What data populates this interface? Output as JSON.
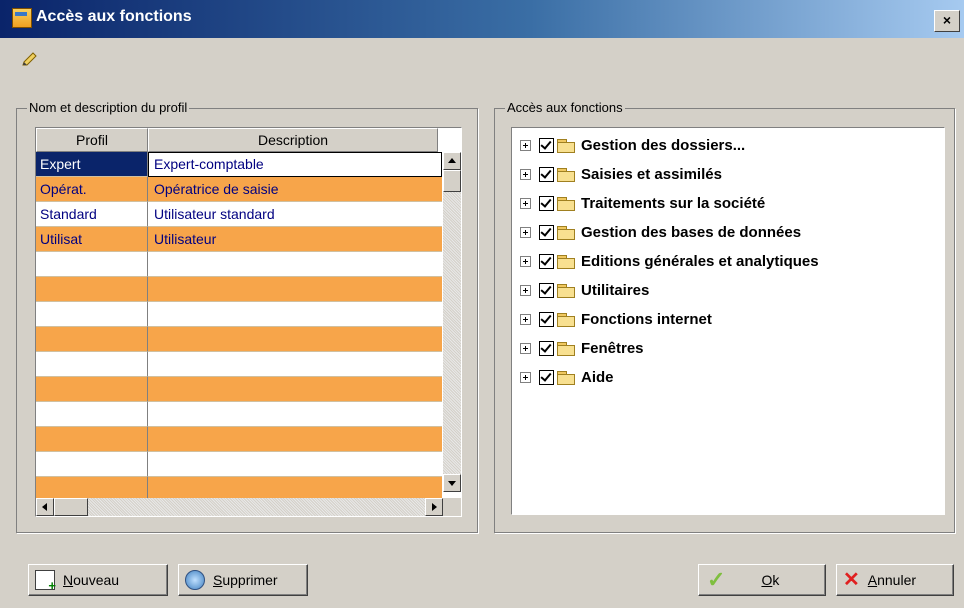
{
  "window": {
    "title": "Accès aux fonctions",
    "close_label": "×"
  },
  "profile_group": {
    "label": "Nom et description du profil",
    "columns": [
      "Profil",
      "Description"
    ],
    "rows": [
      {
        "profil": "Expert",
        "description": "Expert-comptable"
      },
      {
        "profil": "Opérat.",
        "description": "Opératrice de saisie"
      },
      {
        "profil": "Standard",
        "description": "Utilisateur standard"
      },
      {
        "profil": "Utilisat",
        "description": "Utilisateur"
      },
      {
        "profil": "",
        "description": ""
      },
      {
        "profil": "",
        "description": ""
      },
      {
        "profil": "",
        "description": ""
      },
      {
        "profil": "",
        "description": ""
      },
      {
        "profil": "",
        "description": ""
      },
      {
        "profil": "",
        "description": ""
      },
      {
        "profil": "",
        "description": ""
      },
      {
        "profil": "",
        "description": ""
      },
      {
        "profil": "",
        "description": ""
      },
      {
        "profil": "",
        "description": ""
      }
    ],
    "selected_row": 0
  },
  "access_group": {
    "label": "Accès aux fonctions",
    "items": [
      {
        "label": "Gestion des dossiers...",
        "checked": true
      },
      {
        "label": "Saisies et assimilés",
        "checked": true
      },
      {
        "label": "Traitements sur la société",
        "checked": true
      },
      {
        "label": "Gestion des bases de données",
        "checked": true
      },
      {
        "label": "Editions générales et analytiques",
        "checked": true
      },
      {
        "label": "Utilitaires",
        "checked": true
      },
      {
        "label": "Fonctions internet",
        "checked": true
      },
      {
        "label": "Fenêtres",
        "checked": true
      },
      {
        "label": "Aide",
        "checked": true
      }
    ]
  },
  "buttons": {
    "nouveau": {
      "accel": "N",
      "rest": "ouveau"
    },
    "supprimer": {
      "accel": "S",
      "rest": "upprimer"
    },
    "ok": {
      "accel": "O",
      "rest": "k"
    },
    "annuler": {
      "accel": "A",
      "rest": "nnuler"
    }
  },
  "colors": {
    "row_alt": "#f7a54a",
    "selection": "#0a246a",
    "text": "#000080"
  }
}
